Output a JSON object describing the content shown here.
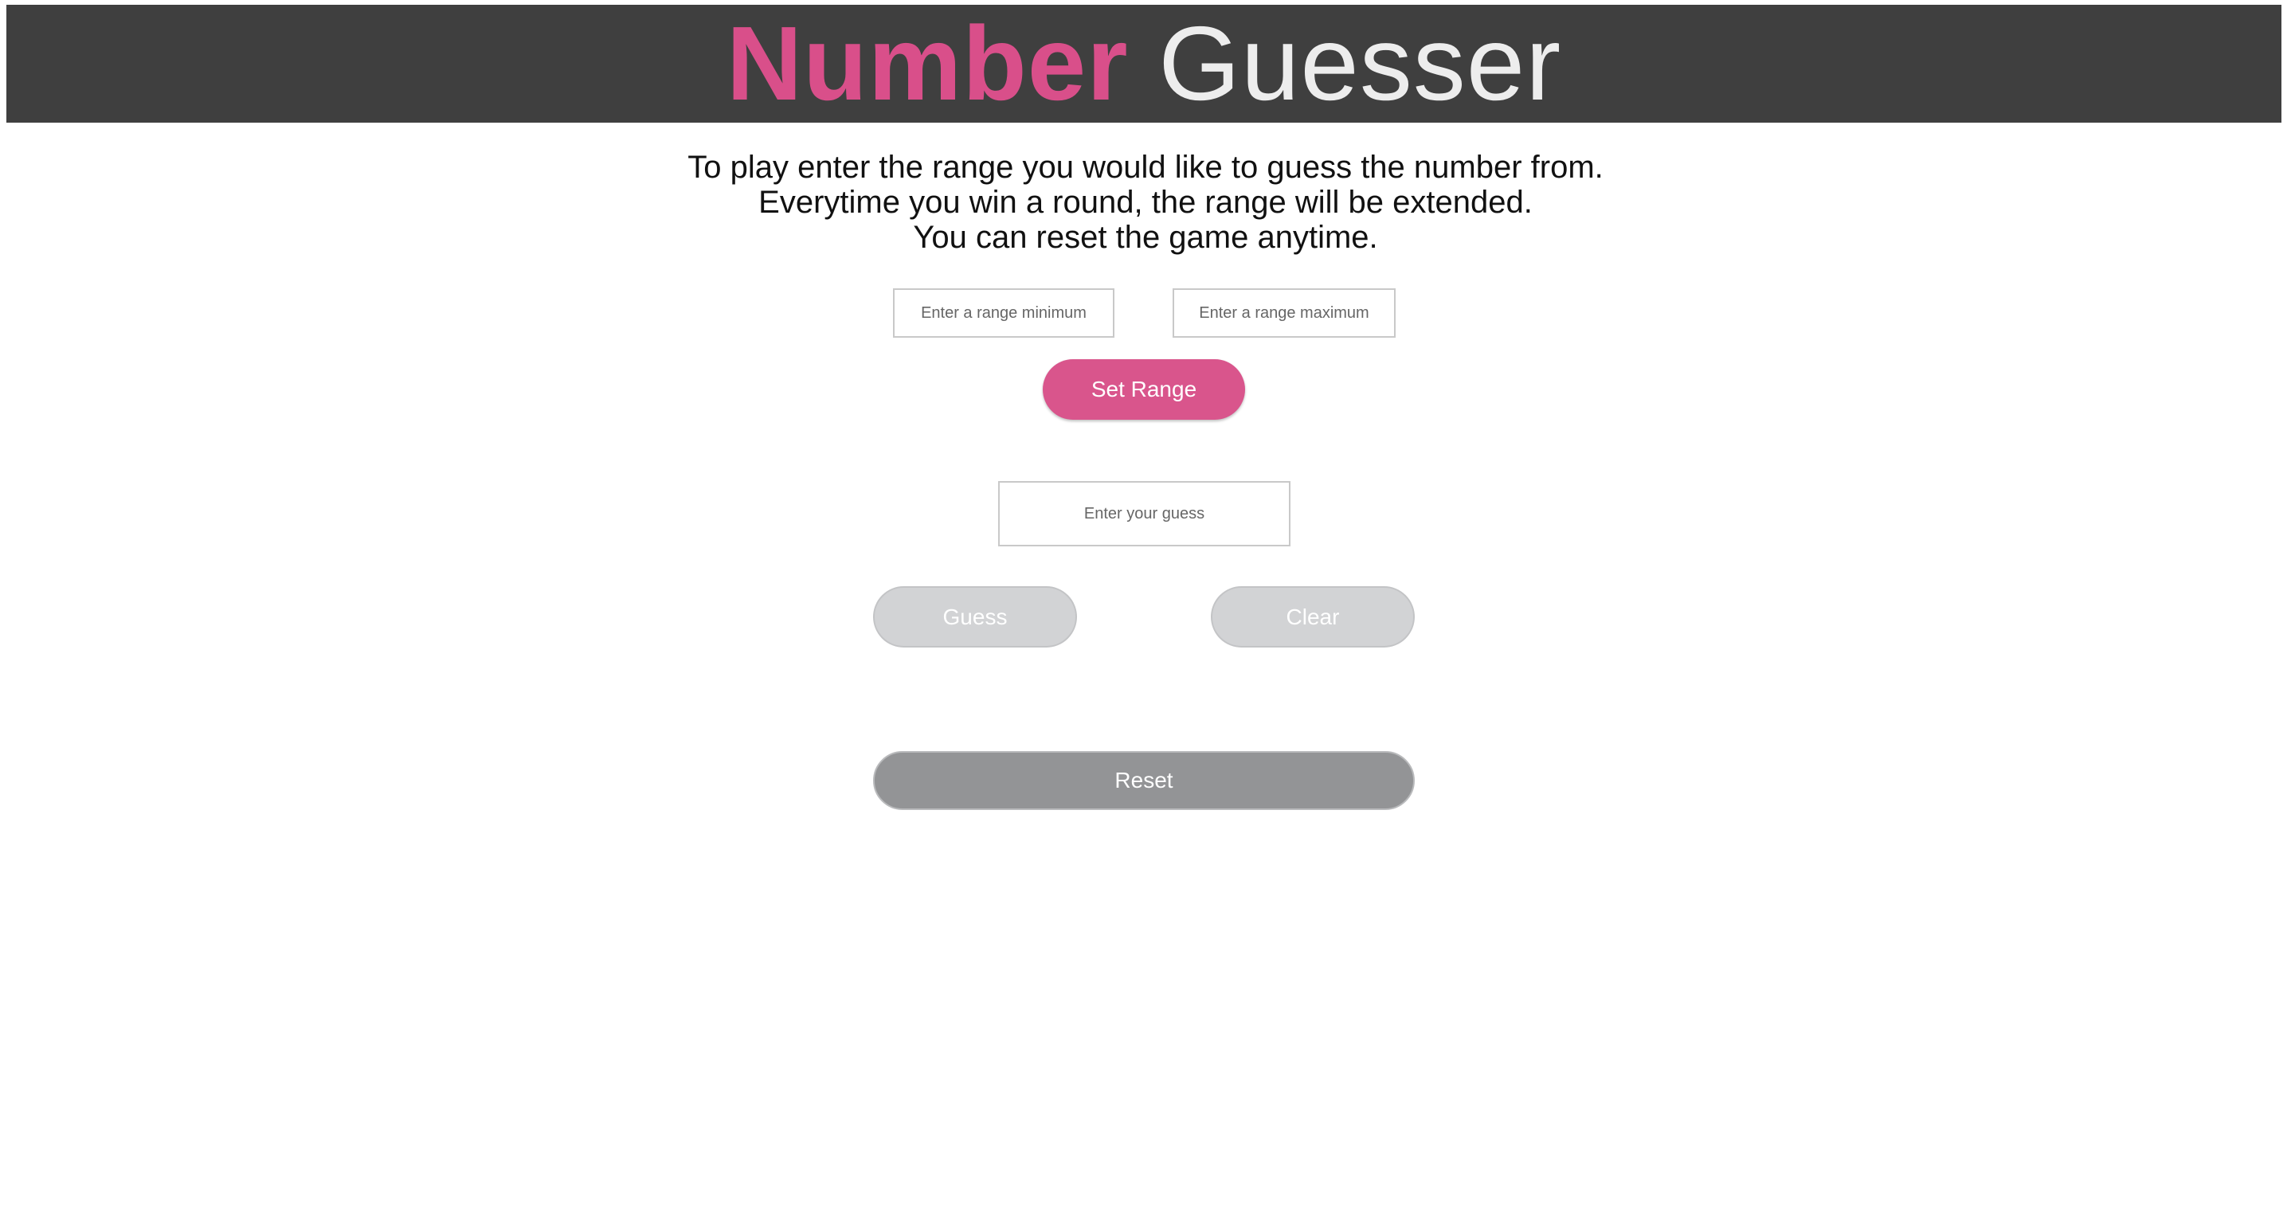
{
  "header": {
    "title_strong": "Number",
    "title_light": "Guesser"
  },
  "instructions": {
    "line1": "To play enter the range you would like to guess the number from.",
    "line2": "Everytime you win a round, the range will be extended.",
    "line3": "You can reset the game anytime."
  },
  "range": {
    "min_placeholder": "Enter a range minimum",
    "max_placeholder": "Enter a range maximum",
    "min_value": "",
    "max_value": "",
    "set_label": "Set Range"
  },
  "guess": {
    "placeholder": "Enter your guess",
    "value": "",
    "guess_label": "Guess",
    "clear_label": "Clear"
  },
  "reset": {
    "label": "Reset"
  },
  "colors": {
    "accent_pink": "#d9558c",
    "header_bg": "#3f3f3f",
    "disabled_button": "#d2d3d5",
    "reset_button": "#939496"
  }
}
